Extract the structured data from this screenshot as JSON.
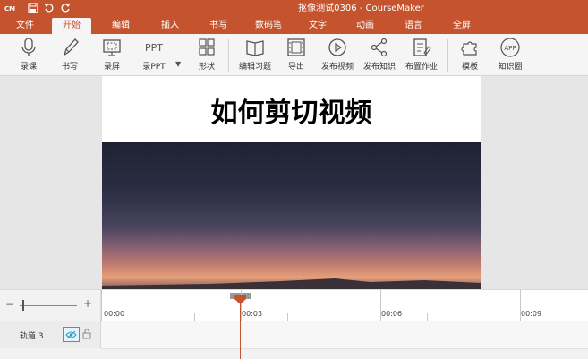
{
  "titlebar": {
    "logo": "CM",
    "title": "抠像测试0306 - CourseMaker"
  },
  "menu": {
    "tabs": [
      "文件",
      "开始",
      "编辑",
      "插入",
      "书写",
      "数码笔",
      "文字",
      "动画",
      "语言",
      "全屏"
    ],
    "active_index": 1
  },
  "ribbon": {
    "buttons": [
      {
        "label": "录课",
        "icon": "microphone-icon"
      },
      {
        "label": "书写",
        "icon": "pen-icon"
      },
      {
        "label": "录屏",
        "icon": "screen-record-icon"
      },
      {
        "label": "录PPT",
        "icon": "ppt-icon",
        "icon_text": "PPT"
      },
      {
        "label": "形状",
        "icon": "shapes-icon"
      },
      {
        "label": "编辑习题",
        "icon": "book-icon"
      },
      {
        "label": "导出",
        "icon": "film-icon"
      },
      {
        "label": "发布视频",
        "icon": "play-circle-icon"
      },
      {
        "label": "发布知识",
        "icon": "share-icon"
      },
      {
        "label": "布置作业",
        "icon": "document-edit-icon"
      },
      {
        "label": "模板",
        "icon": "puzzle-icon"
      },
      {
        "label": "知识圈",
        "icon": "app-icon",
        "icon_text": "APP"
      }
    ]
  },
  "slide": {
    "title": "如何剪切视频"
  },
  "timeline": {
    "ticks": [
      "00:00",
      "00:03",
      "00:06",
      "00:09"
    ],
    "playhead": "00:03",
    "track_name": "轨道 3"
  },
  "colors": {
    "accent": "#c4532e",
    "track_eye": "#2a9fd6"
  }
}
